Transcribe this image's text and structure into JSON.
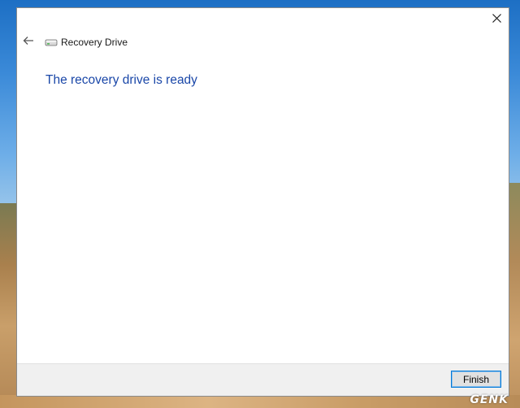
{
  "window": {
    "title": "Recovery Drive",
    "heading": "The recovery drive is ready",
    "finish_label": "Finish",
    "heading_color": "#1a47a8",
    "accent_color": "#0078d7"
  },
  "icons": {
    "back": "back-arrow-icon",
    "close": "close-icon",
    "drive": "drive-icon"
  },
  "watermark": {
    "text": "GENK"
  }
}
